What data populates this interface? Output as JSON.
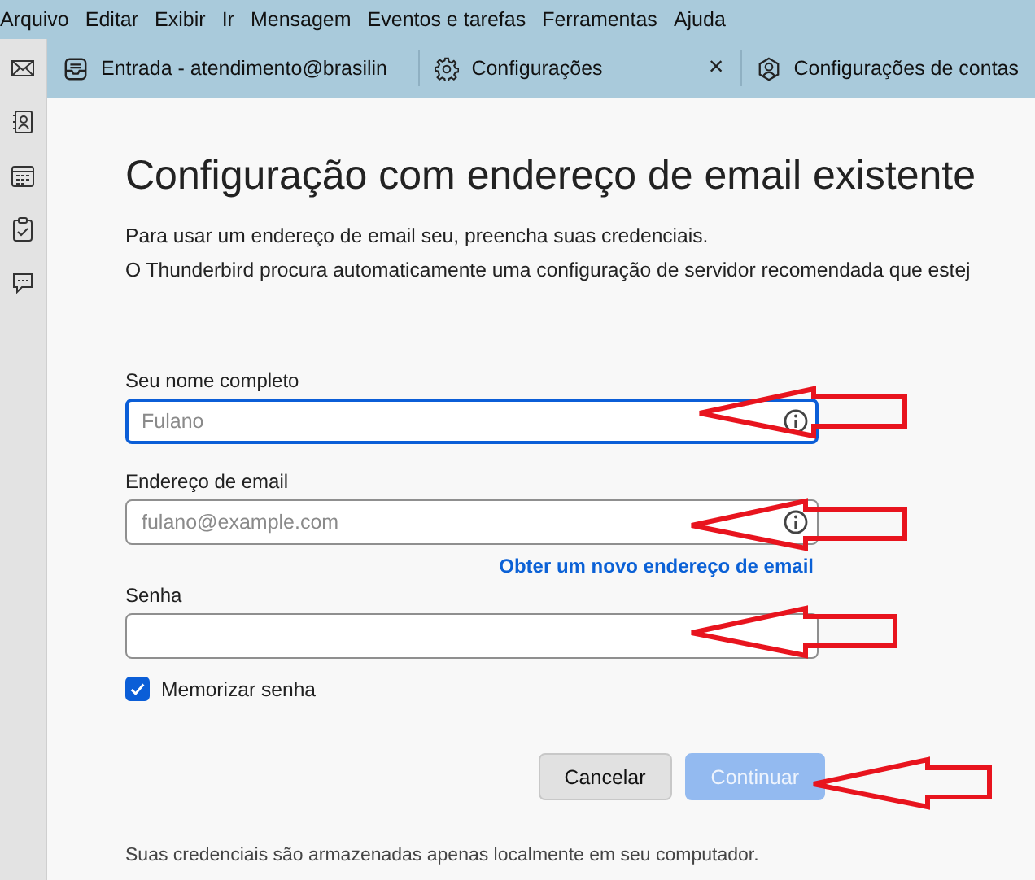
{
  "menu_bar": [
    "Arquivo",
    "Editar",
    "Exibir",
    "Ir",
    "Mensagem",
    "Eventos e tarefas",
    "Ferramentas",
    "Ajuda"
  ],
  "sidebar": [
    {
      "kind": "mail"
    },
    {
      "kind": "contacts"
    },
    {
      "kind": "calendar"
    },
    {
      "kind": "tasks"
    },
    {
      "kind": "chat"
    }
  ],
  "tabs": [
    {
      "kind": "inbox",
      "label": "Entrada - atendimento@brasilin"
    },
    {
      "kind": "settings",
      "label": "Configurações",
      "close": "×"
    },
    {
      "kind": "accounts",
      "label": "Configurações de contas"
    }
  ],
  "form": {
    "title": "Configuração com endereço de email existente",
    "intro": [
      "Para usar um endereço de email seu, preencha suas credenciais.",
      "O Thunderbird procura automaticamente uma configuração de servidor recomendada que estej"
    ],
    "fields": [
      {
        "label": "Seu nome completo",
        "placeholder": "Fulano",
        "focused": true,
        "info": true
      },
      {
        "label": "Endereço de email",
        "placeholder": "fulano@example.com",
        "focused": false,
        "info": true,
        "link": "Obter um novo endereço de email"
      },
      {
        "label": "Senha",
        "focused": false,
        "info": false
      }
    ],
    "remember": {
      "label": "Memorizar senha",
      "checked": true
    },
    "buttons": [
      {
        "label": "Cancelar",
        "kind": "secondary",
        "disabled": false
      },
      {
        "label": "Continuar",
        "kind": "primary",
        "disabled": true
      }
    ],
    "footer": "Suas credenciais são armazenadas apenas localmente em seu computador."
  }
}
